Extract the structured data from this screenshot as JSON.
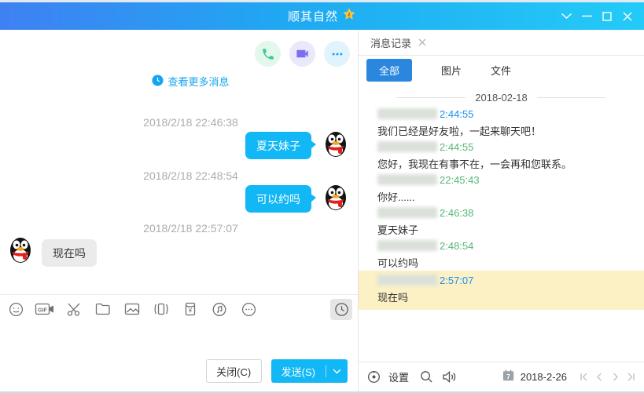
{
  "titlebar": {
    "title": "顺其自然",
    "badge_icon": "gold-star-z",
    "controls": [
      "chevron-down",
      "minimize",
      "maximize",
      "close"
    ]
  },
  "chat": {
    "action_icons": [
      "voice-call",
      "video-call",
      "more-options"
    ],
    "view_more": "查看更多消息",
    "timestamps": [
      "2018/2/18 22:46:38",
      "2018/2/18 22:48:54",
      "2018/2/18 22:57:07"
    ],
    "sent": [
      {
        "text": "夏天妹子"
      },
      {
        "text": "可以约吗"
      }
    ],
    "received": [
      {
        "text": "现在吗"
      }
    ],
    "toolbar_icons": [
      "emoji",
      "gif",
      "screenshot",
      "folder",
      "image",
      "window-shake",
      "red-packet",
      "music",
      "more",
      "message-history"
    ],
    "close_button": "关闭(C)",
    "send_button": "发送(S)"
  },
  "history": {
    "tab": "消息记录",
    "filters": [
      "全部",
      "图片",
      "文件"
    ],
    "active_filter": "全部",
    "date_separator": "2018-02-18",
    "entries": [
      {
        "time": "2:44:55",
        "color": "blue",
        "text": "我们已经是好友啦，一起来聊天吧！",
        "highlight": false
      },
      {
        "time": "2:44:55",
        "color": "green",
        "text": "您好，我现在有事不在，一会再和您联系。",
        "highlight": false
      },
      {
        "time": "22:45:43",
        "color": "green",
        "text": "你好......",
        "highlight": false
      },
      {
        "time": "2:46:38",
        "color": "green",
        "text": "夏天妹子",
        "highlight": false
      },
      {
        "time": "2:48:54",
        "color": "green",
        "text": "可以约吗",
        "highlight": false
      },
      {
        "time": "2:57:07",
        "color": "blue",
        "text": "现在吗",
        "highlight": true
      }
    ],
    "footer": {
      "settings_label": "设置",
      "calendar_day": "7",
      "date": "2018-2-26",
      "nav_icons": [
        "first-page",
        "prev-page",
        "next-page",
        "last-page"
      ]
    }
  },
  "colors": {
    "accent_blue": "#12b7f5",
    "titlebar_gradient_start": "#3f80f3",
    "titlebar_gradient_end": "#24cbf7",
    "tab_active_blue": "#2b87dd",
    "time_blue": "#1591f0",
    "time_green": "#58b578",
    "highlight_yellow": "#fcf0c5",
    "call_green": "#3ec98c",
    "video_purple": "#7a70ee"
  }
}
